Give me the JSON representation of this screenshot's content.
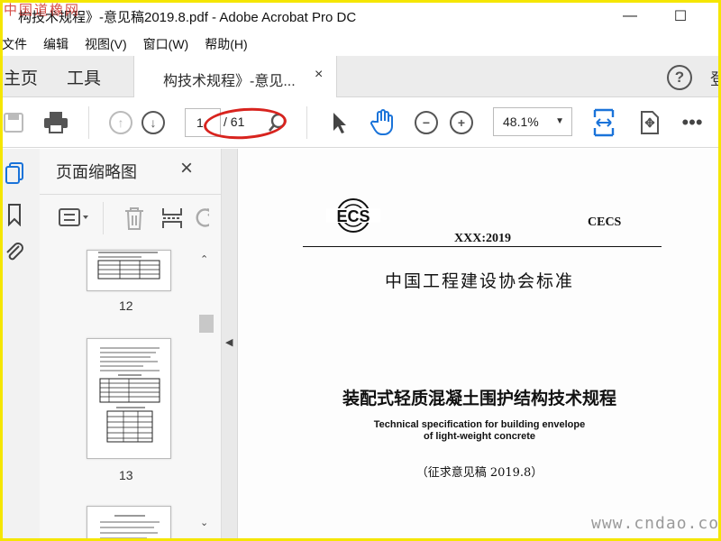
{
  "window": {
    "title": "构技术规程》-意见稿2019.8.pdf - Adobe Acrobat Pro DC",
    "watermark_top": "中国道橡网",
    "minimize": "—",
    "maximize": "☐"
  },
  "menu": [
    "文件",
    "编辑",
    "视图(V)",
    "窗口(W)",
    "帮助(H)"
  ],
  "nav": {
    "home": "主页",
    "tools": "工具",
    "doc_tab_label": "构技术规程》-意见...",
    "doc_tab_close": "×",
    "help": "?",
    "sign_cut": "登"
  },
  "toolbar": {
    "page_current": "1",
    "page_total": "/ 61",
    "zoom": "48.1%"
  },
  "thumbnail_panel": {
    "title": "页面缩略图",
    "close": "×",
    "pages": [
      {
        "number": "12"
      },
      {
        "number": "13"
      }
    ]
  },
  "document": {
    "logo_text": "ECS",
    "code": "XXX:2019",
    "series": "CECS",
    "association": "中国工程建设协会标准",
    "title_cn": "装配式轻质混凝土围护结构技术规程",
    "title_en_line1": "Technical specification for building envelope",
    "title_en_line2": "of light-weight concrete",
    "draft_note": "（征求意见稿 2019.8）"
  },
  "watermark_bottom": "www.cndao.com",
  "colors": {
    "frame": "#f5e600",
    "accent_blue": "#1a73d9",
    "annotation_red": "#d8231e"
  }
}
